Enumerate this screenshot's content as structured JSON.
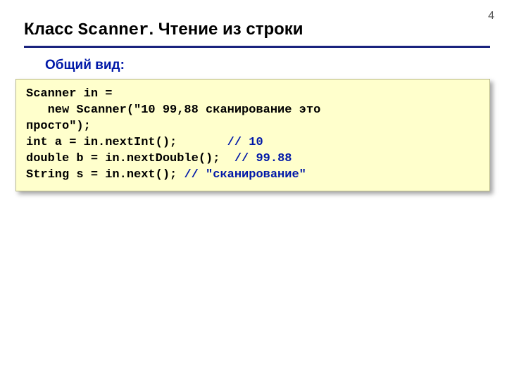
{
  "pageNumber": "4",
  "title": {
    "pre": "Класс ",
    "mono": "Scanner",
    "post": ". Чтение из строки"
  },
  "subtitle": "Общий вид:",
  "code": {
    "l1": "Scanner in = ",
    "l2": "   new Scanner(\"10 99,88 сканирование это",
    "l3": "просто\");",
    "l4a": "int a = in.nextInt();       ",
    "l4c": "// 10",
    "l5a": "double b = in.nextDouble();  ",
    "l5c": "// 99.88",
    "l6a": "String s = in.next(); ",
    "l6c": "// \"сканирование\""
  }
}
